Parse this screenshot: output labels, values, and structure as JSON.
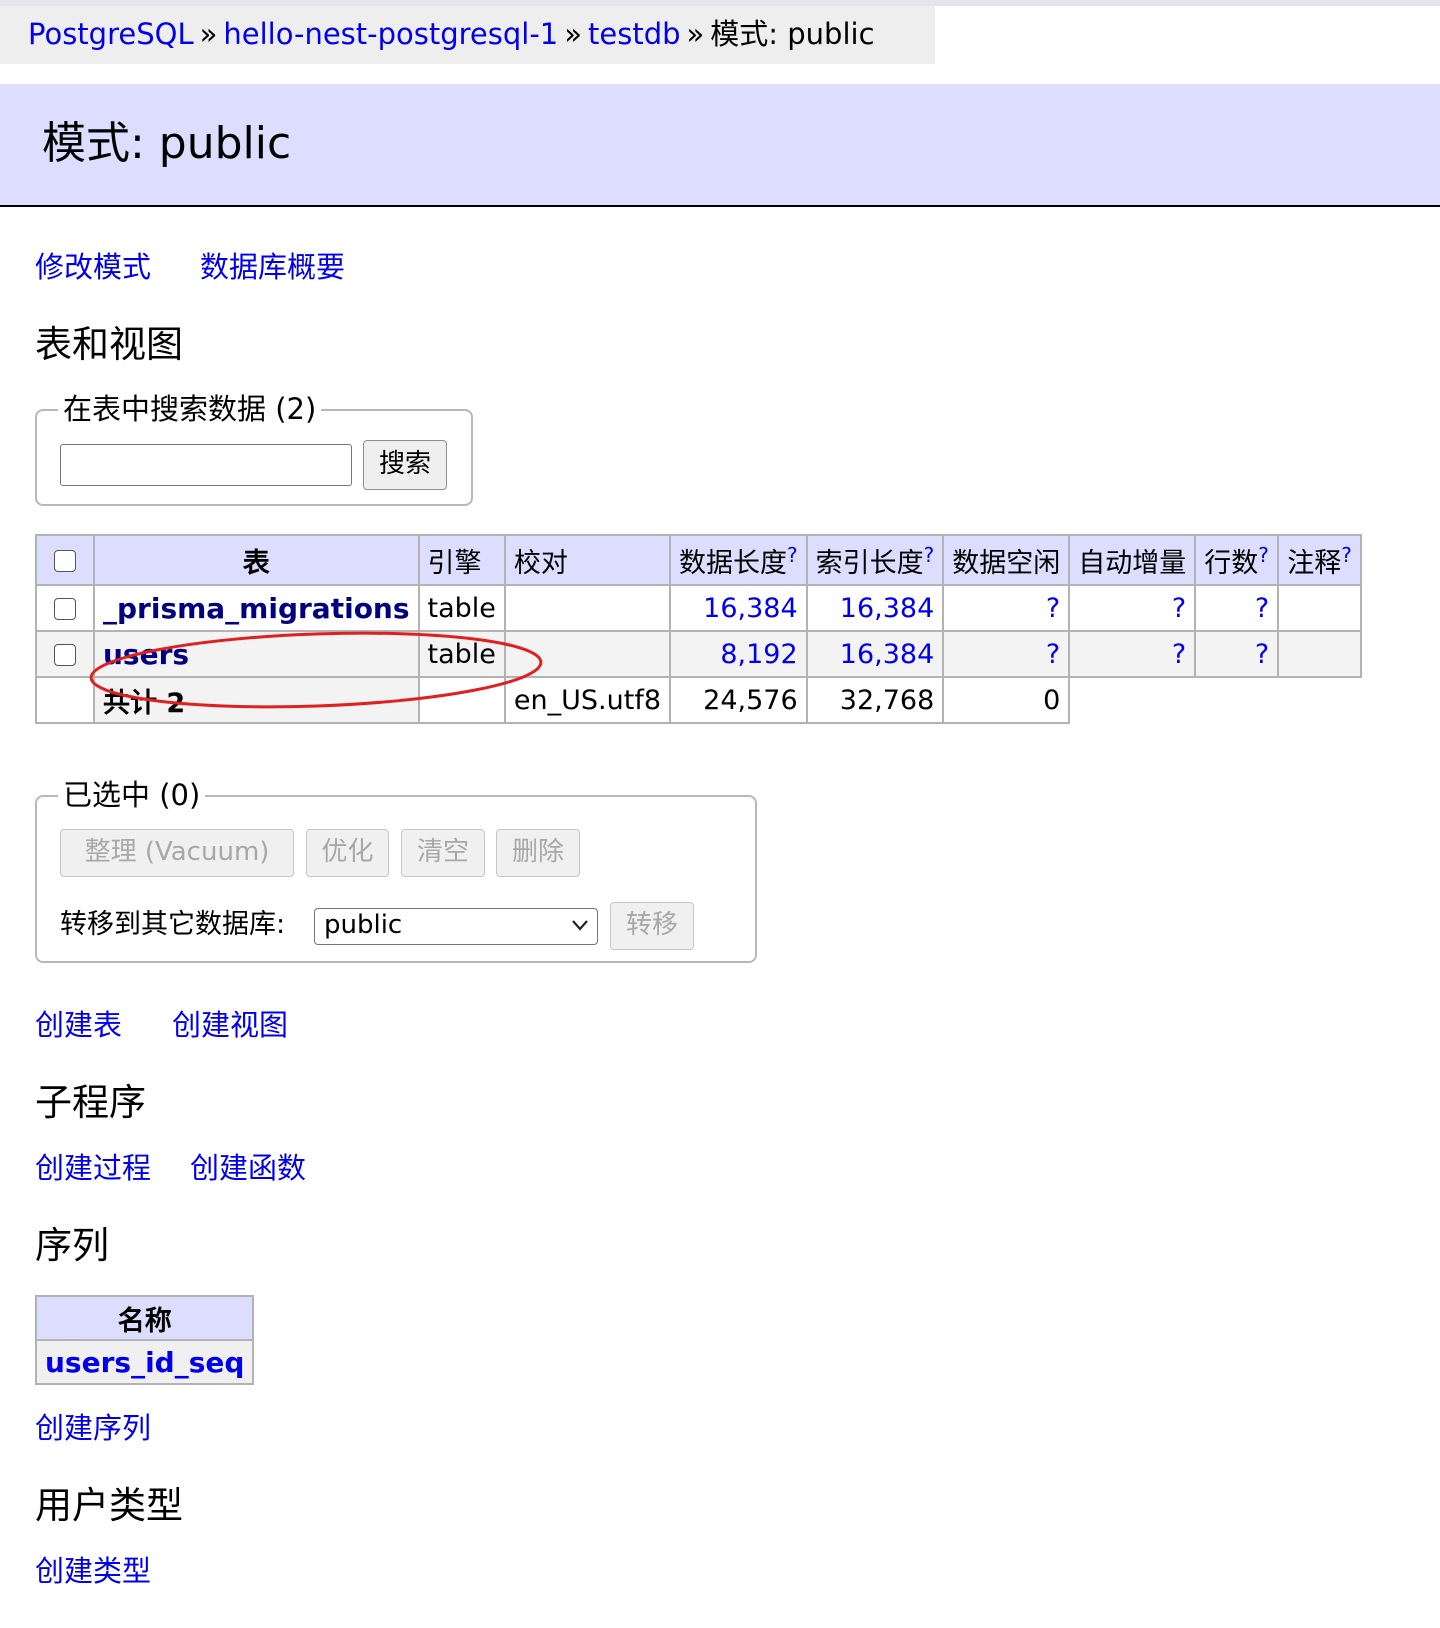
{
  "breadcrumb": {
    "items": [
      "PostgreSQL",
      "hello-nest-postgresql-1",
      "testdb"
    ],
    "separator": "»",
    "current": "模式: public"
  },
  "page_title": "模式: public",
  "top_links": [
    "修改模式",
    "数据库概要"
  ],
  "tables_section": {
    "heading": "表和视图",
    "search": {
      "legend": "在表中搜索数据 (2)",
      "value": "",
      "button": "搜索"
    },
    "columns": [
      "表",
      "引擎",
      "校对",
      "数据长度",
      "索引长度",
      "数据空闲",
      "自动增量",
      "行数",
      "注释"
    ],
    "help_mark": "?",
    "rows": [
      {
        "name": "_prisma_migrations",
        "engine": "table",
        "collation": "",
        "data_length": "16,384",
        "index_length": "16,384",
        "data_free": "?",
        "auto_increment": "?",
        "rows": "?",
        "comment": ""
      },
      {
        "name": "users",
        "engine": "table",
        "collation": "",
        "data_length": "8,192",
        "index_length": "16,384",
        "data_free": "?",
        "auto_increment": "?",
        "rows": "?",
        "comment": ""
      }
    ],
    "total": {
      "label": "共计",
      "count": "2",
      "collation": "en_US.utf8",
      "data_length": "24,576",
      "index_length": "32,768",
      "data_free": "0"
    }
  },
  "selected_section": {
    "legend": "已选中 (0)",
    "buttons": [
      "整理 (Vacuum)",
      "优化",
      "清空",
      "删除"
    ],
    "move_label": "转移到其它数据库:",
    "move_select": "public",
    "move_button": "转移"
  },
  "table_links": [
    "创建表",
    "创建视图"
  ],
  "routines": {
    "heading": "子程序",
    "links": [
      "创建过程",
      "创建函数"
    ]
  },
  "sequences": {
    "heading": "序列",
    "column": "名称",
    "items": [
      "users_id_seq"
    ],
    "link": "创建序列"
  },
  "user_types": {
    "heading": "用户类型",
    "link": "创建类型"
  },
  "colors": {
    "header_bg": "#dddeff",
    "link": "#0000ee",
    "table_name": "#000080",
    "annotation": "#e0201e"
  }
}
